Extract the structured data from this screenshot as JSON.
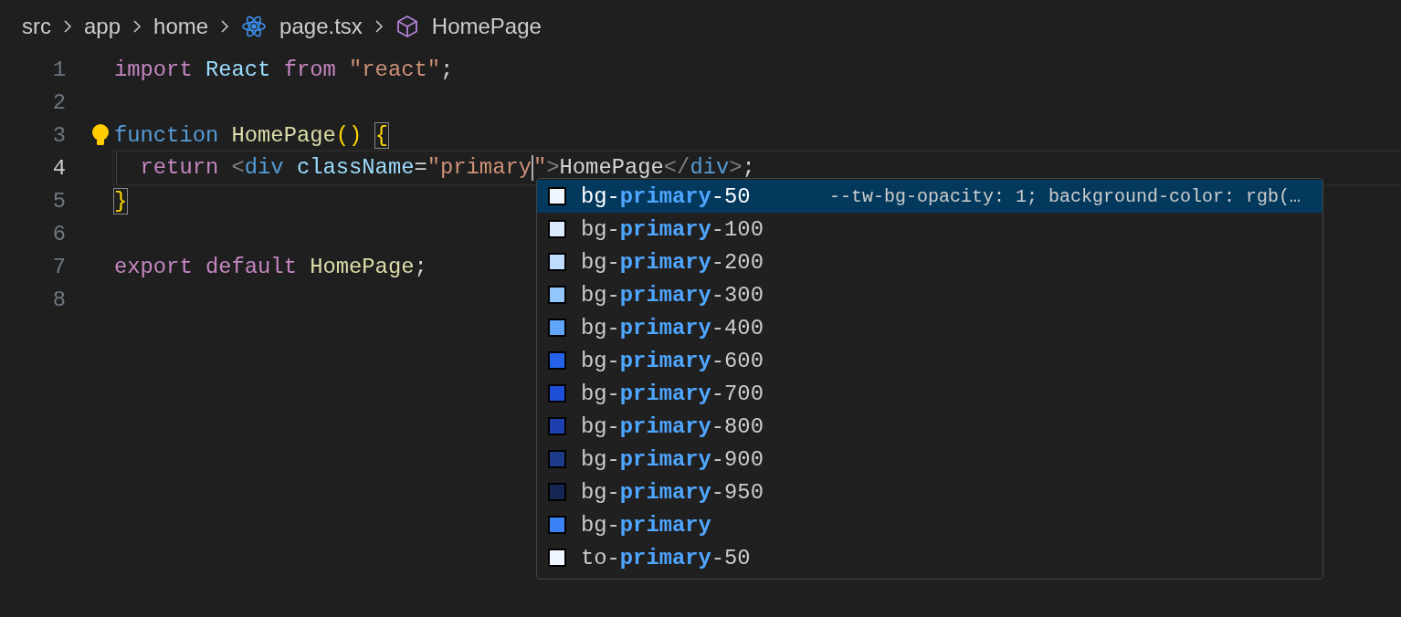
{
  "breadcrumb": [
    {
      "text": "src",
      "kind": "folder"
    },
    {
      "text": "app",
      "kind": "folder"
    },
    {
      "text": "home",
      "kind": "folder"
    },
    {
      "text": "page.tsx",
      "kind": "file"
    },
    {
      "text": "HomePage",
      "kind": "symbol"
    }
  ],
  "editor": {
    "lines": [
      {
        "number": "1",
        "current": false,
        "lightbulb": false,
        "tokens": [
          {
            "text": "import ",
            "kind": "keyword"
          },
          {
            "text": "React ",
            "kind": "variable"
          },
          {
            "text": "from ",
            "kind": "keyword"
          },
          {
            "text": "\"react\"",
            "kind": "string"
          },
          {
            "text": ";",
            "kind": "plain"
          }
        ]
      },
      {
        "number": "2",
        "current": false,
        "lightbulb": false
      },
      {
        "number": "3",
        "current": false,
        "lightbulb": true,
        "tokens": [
          {
            "text": "function ",
            "kind": "storage"
          },
          {
            "text": "HomePage",
            "kind": "function"
          },
          {
            "text": "() ",
            "kind": "paren"
          },
          {
            "text": "{",
            "kind": "bracket-match"
          }
        ]
      },
      {
        "number": "4",
        "current": true,
        "lightbulb": false,
        "tokens": [
          {
            "text": "  return ",
            "kind": "keyword"
          },
          {
            "text": "<",
            "kind": "punct"
          },
          {
            "text": "div ",
            "kind": "tag"
          },
          {
            "text": "className",
            "kind": "attr"
          },
          {
            "text": "=",
            "kind": "plain"
          },
          {
            "text": "\"primary",
            "kind": "string-before-caret"
          },
          {
            "text": "\"",
            "kind": "string"
          },
          {
            "text": ">",
            "kind": "punct"
          },
          {
            "text": "HomePage",
            "kind": "plain"
          },
          {
            "text": "</",
            "kind": "punct"
          },
          {
            "text": "div",
            "kind": "tag"
          },
          {
            "text": ">",
            "kind": "punct"
          },
          {
            "text": ";",
            "kind": "plain"
          }
        ]
      },
      {
        "number": "5",
        "current": false,
        "lightbulb": false,
        "tokens": [
          {
            "text": "}",
            "kind": "bracket-match"
          }
        ]
      },
      {
        "number": "6",
        "current": false,
        "lightbulb": false
      },
      {
        "number": "7",
        "current": false,
        "lightbulb": false,
        "tokens": [
          {
            "text": "export ",
            "kind": "keyword"
          },
          {
            "text": "default ",
            "kind": "keyword"
          },
          {
            "text": "HomePage",
            "kind": "function"
          },
          {
            "text": ";",
            "kind": "plain"
          }
        ]
      },
      {
        "number": "8",
        "current": false,
        "lightbulb": false
      }
    ]
  },
  "suggestions": [
    {
      "label": "bg-**primary**-50",
      "color": "#eff6ff",
      "selected": true,
      "detail": "--tw-bg-opacity: 1; background-color: rgb(…"
    },
    {
      "label": "bg-**primary**-100",
      "color": "#dbeafe",
      "selected": false
    },
    {
      "label": "bg-**primary**-200",
      "color": "#bfdbfe",
      "selected": false
    },
    {
      "label": "bg-**primary**-300",
      "color": "#93c5fd",
      "selected": false
    },
    {
      "label": "bg-**primary**-400",
      "color": "#60a5fa",
      "selected": false
    },
    {
      "label": "bg-**primary**-600",
      "color": "#2563eb",
      "selected": false
    },
    {
      "label": "bg-**primary**-700",
      "color": "#1d4ed8",
      "selected": false
    },
    {
      "label": "bg-**primary**-800",
      "color": "#1e40af",
      "selected": false
    },
    {
      "label": "bg-**primary**-900",
      "color": "#1e3a8a",
      "selected": false
    },
    {
      "label": "bg-**primary**-950",
      "color": "#172554",
      "selected": false
    },
    {
      "label": "bg-**primary**",
      "color": "#3b82f6",
      "selected": false
    },
    {
      "label": "to-**primary**-50",
      "color": "#eff6ff",
      "selected": false
    }
  ]
}
